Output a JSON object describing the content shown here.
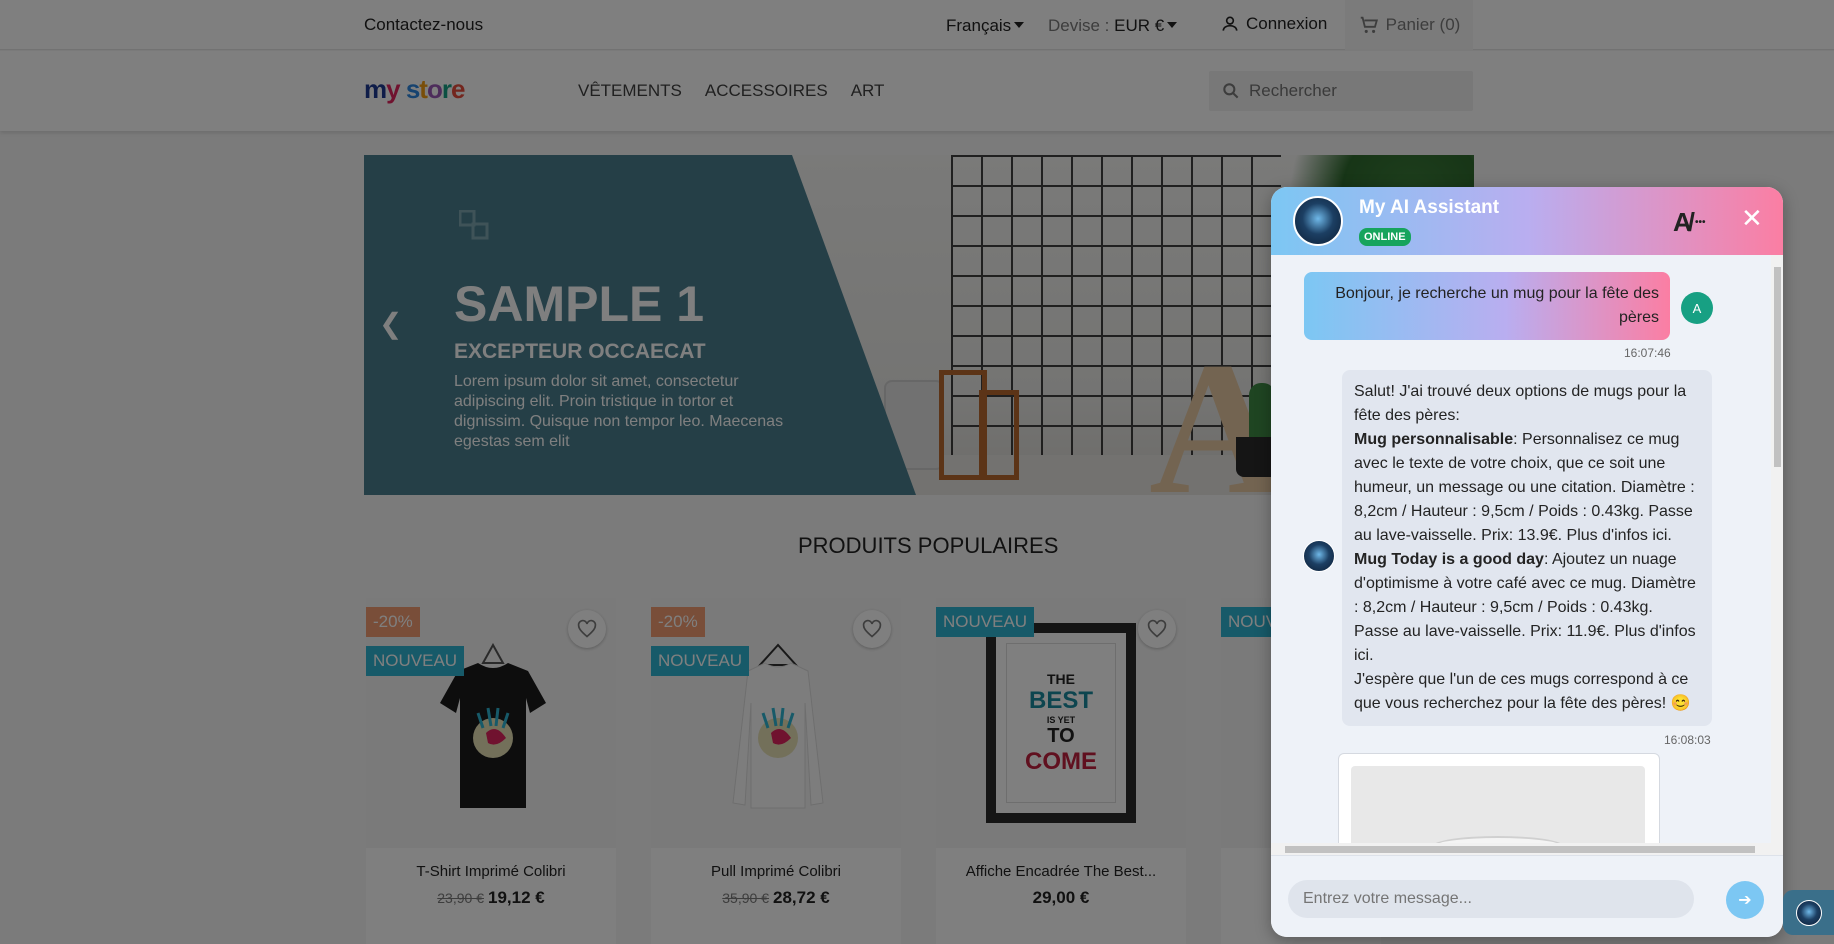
{
  "topbar": {
    "contact": "Contactez-nous",
    "language": "Français",
    "currency_label": "Devise :",
    "currency_value": "EUR €",
    "login": "Connexion",
    "cart": "Panier (0)"
  },
  "header": {
    "logo": [
      "m",
      "y",
      " ",
      "s",
      "t",
      "o",
      "r",
      "e"
    ],
    "nav": [
      "VÊTEMENTS",
      "ACCESSOIRES",
      "ART"
    ],
    "search_placeholder": "Rechercher"
  },
  "banner": {
    "title": "SAMPLE 1",
    "subtitle": "EXCEPTEUR OCCAECAT",
    "text": "Lorem ipsum dolor sit amet, consectetur adipiscing elit. Proin tristique in tortor et dignissim. Quisque non tempor leo. Maecenas egestas sem elit"
  },
  "products_section": {
    "title": "PRODUITS POPULAIRES",
    "items": [
      {
        "name": "T-Shirt Imprimé Colibri",
        "old_price": "23,90 €",
        "price": "19,12 €",
        "discount": "-20%",
        "flag": "NOUVEAU"
      },
      {
        "name": "Pull Imprimé Colibri",
        "old_price": "35,90 €",
        "price": "28,72 €",
        "discount": "-20%",
        "flag": "NOUVEAU"
      },
      {
        "name": "Affiche Encadrée The Best...",
        "price": "29,00 €",
        "flag": "NOUVEAU"
      },
      {
        "flag": "NOUVEAU"
      }
    ],
    "poster_text": [
      "THE",
      "BEST",
      "IS YET",
      "TO",
      "COME"
    ]
  },
  "chat": {
    "title": "My AI Assistant",
    "status": "ONLINE",
    "brand": "A",
    "user_initial": "A",
    "user_message": "Bonjour, je recherche un mug pour la fête des pères",
    "user_time": "16:07:46",
    "bot_intro": "Salut! J'ai trouvé deux options de mugs pour la fête des pères:",
    "bot_item1_name": "Mug personnalisable",
    "bot_item1_text": ": Personnalisez ce mug avec le texte de votre choix, que ce soit une humeur, un message ou une citation. Diamètre : 8,2cm / Hauteur : 9,5cm / Poids : 0.43kg. Passe au lave-vaisselle. Prix: 13.9€. Plus d'infos ici.",
    "bot_item2_name": "Mug Today is a good day",
    "bot_item2_text": ": Ajoutez un nuage d'optimisme à votre café avec ce mug. Diamètre : 8,2cm / Hauteur : 9,5cm / Poids : 0.43kg. Passe au lave-vaisselle. Prix: 11.9€. Plus d'infos ici.",
    "bot_outro": "J'espère que l'un de ces mugs correspond à ce que vous recherchez pour la fête des pères! 😊",
    "bot_time": "16:08:03",
    "input_placeholder": "Entrez votre message..."
  },
  "colors": {
    "accent_blue": "#7cc7f3",
    "accent_pink": "#fb7ea3",
    "online_green": "#17a45d",
    "badge_discount": "#f39d72",
    "badge_new": "#2fb5d2"
  }
}
